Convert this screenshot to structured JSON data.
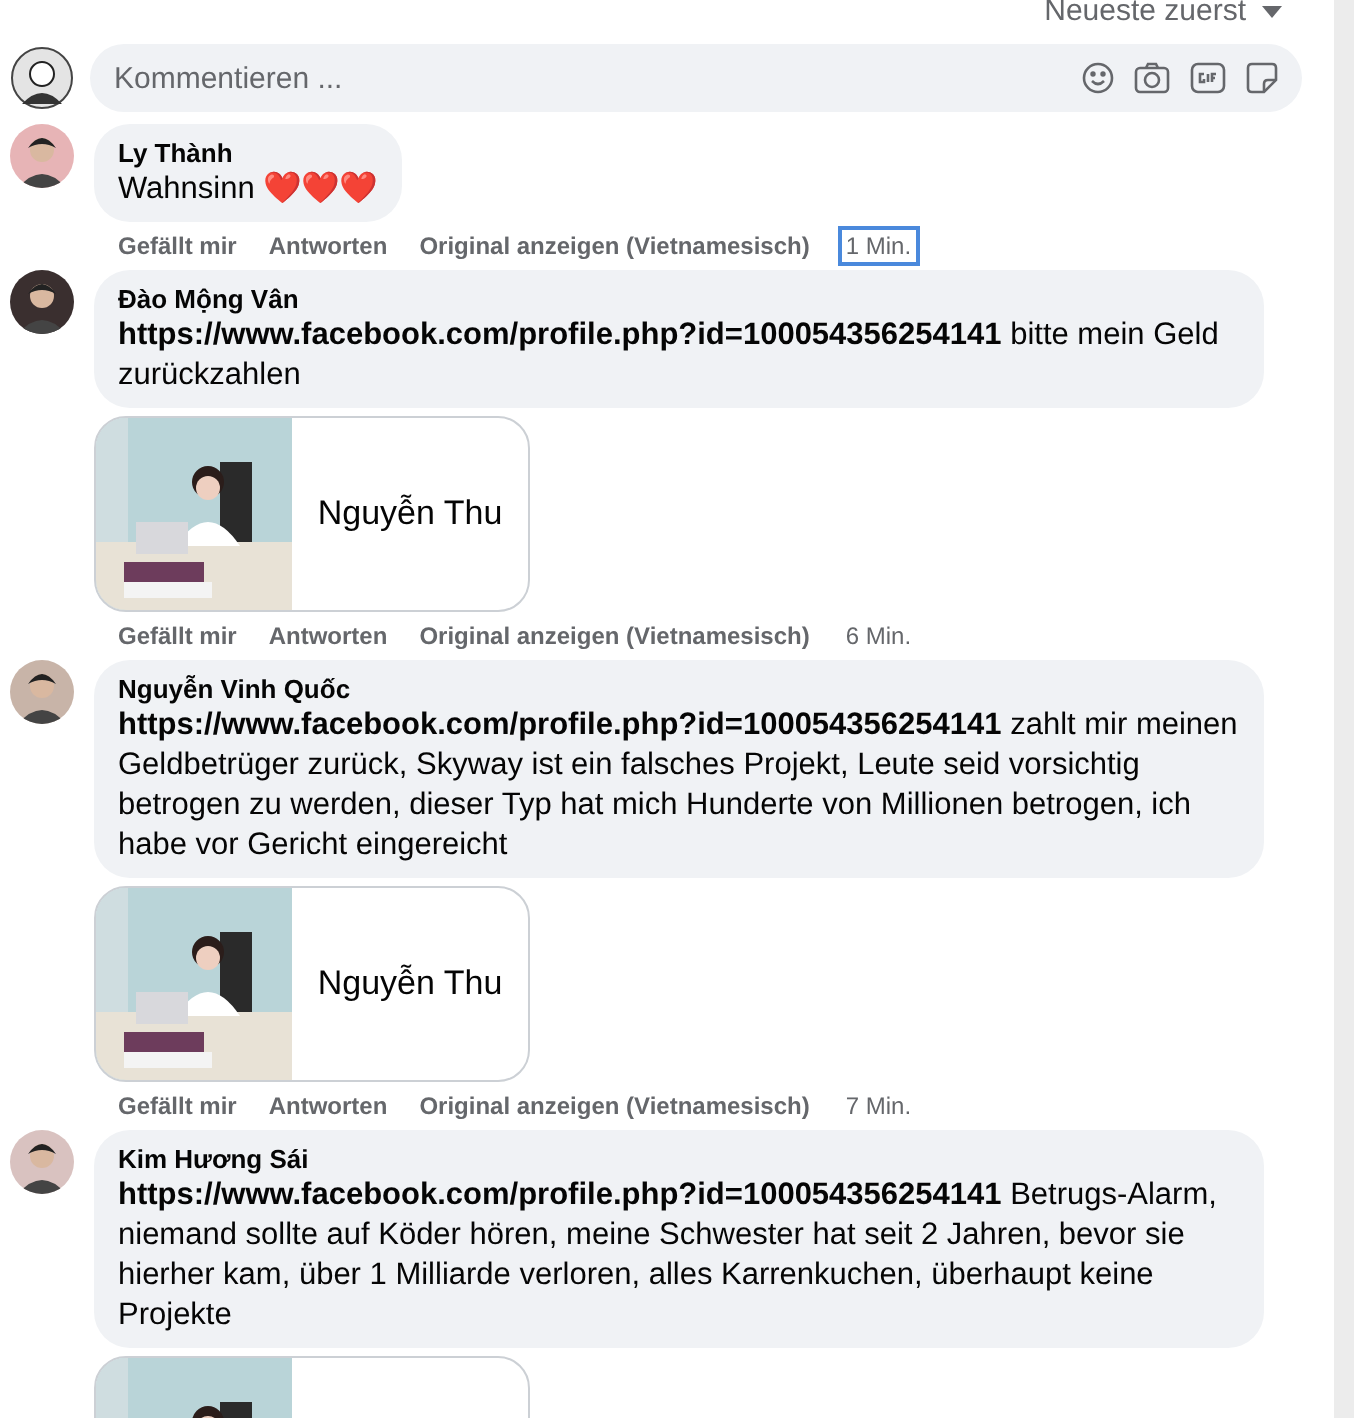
{
  "sort_menu": {
    "label": "Neueste zuerst"
  },
  "composer": {
    "placeholder": "Kommentieren ..."
  },
  "comments": [
    {
      "author": "Ly Thành",
      "text": "Wahnsinn ❤️❤️❤️",
      "actions": [
        "Gefällt mir",
        "Antworten",
        "Original anzeigen (Vietnamesisch)"
      ],
      "time": "1 Min.",
      "time_focused": true
    },
    {
      "author": "Đào Mộng Vân",
      "text": "**https://www.facebook.com/profile.php?id=100054356254141** bitte mein Geld zurückzahlen",
      "attachment": {
        "name": "Nguyễn Thu"
      },
      "actions": [
        "Gefällt mir",
        "Antworten",
        "Original anzeigen (Vietnamesisch)"
      ],
      "time": "6 Min.",
      "time_focused": false
    },
    {
      "author": "Nguyễn Vinh Quốc",
      "text": "**https://www.facebook.com/profile.php?id=100054356254141** zahlt mir meinen Geldbetrüger zurück, Skyway ist ein falsches Projekt, Leute seid vorsichtig betrogen zu werden, dieser Typ hat mich Hunderte von Millionen betrogen, ich habe vor Gericht eingereicht",
      "attachment": {
        "name": "Nguyễn Thu"
      },
      "actions": [
        "Gefällt mir",
        "Antworten",
        "Original anzeigen (Vietnamesisch)"
      ],
      "time": "7 Min.",
      "time_focused": false
    },
    {
      "author": "Kim Hương Sái",
      "text": "**https://www.facebook.com/profile.php?id=100054356254141** Betrugs-Alarm, niemand sollte auf Köder hören, meine Schwester hat seit 2 Jahren, bevor sie hierher kam, über 1 Milliarde verloren, alles Karrenkuchen, überhaupt keine Projekte"
    }
  ]
}
